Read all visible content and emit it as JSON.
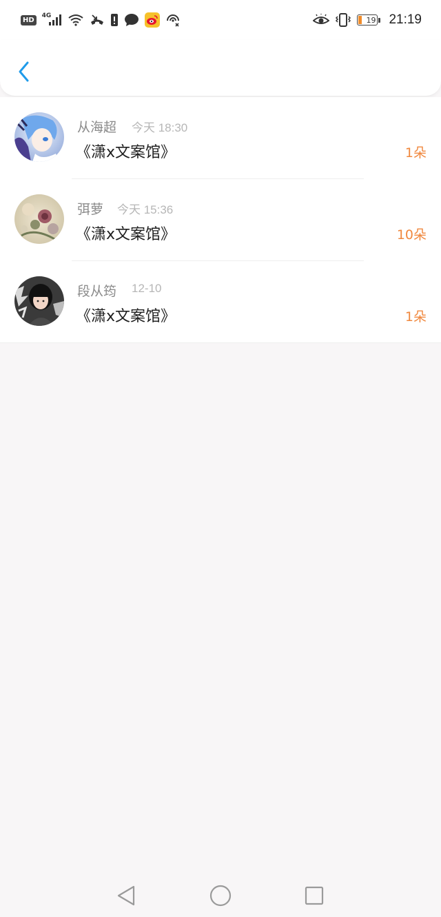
{
  "status_bar": {
    "hd_label": "HD",
    "network_label": "4G",
    "battery_level": "19",
    "battery_fill_fraction": 0.19,
    "time": "21:19",
    "icons": [
      "hd-icon",
      "signal-icon",
      "wifi-icon",
      "missed-call-icon",
      "alert-icon",
      "chat-icon",
      "weibo-icon",
      "hotspot-icon",
      "eye-icon",
      "vibrate-icon",
      "battery-icon"
    ]
  },
  "header": {
    "back_icon": "chevron-left-icon",
    "accent_color": "#1f9bea"
  },
  "items": [
    {
      "name": "从海超",
      "time": "今天 18:30",
      "book": "《潇x文案馆》",
      "gift": "1朵",
      "avatar": "anime-boy-avatar"
    },
    {
      "name": "弭萝",
      "time": "今天 15:36",
      "book": "《潇x文案馆》",
      "gift": "10朵",
      "avatar": "floral-avatar"
    },
    {
      "name": "段从筠",
      "time": "12-10",
      "book": "《潇x文案馆》",
      "gift": "1朵",
      "avatar": "girl-photo-avatar"
    }
  ],
  "colors": {
    "gift": "#f0883e",
    "name": "#8a8a8a",
    "time": "#b6b6b6",
    "book": "#1f1f1f",
    "background": "#f8f6f7"
  },
  "nav_bar": {
    "icons": [
      "back-triangle-icon",
      "home-circle-icon",
      "recents-square-icon"
    ]
  }
}
